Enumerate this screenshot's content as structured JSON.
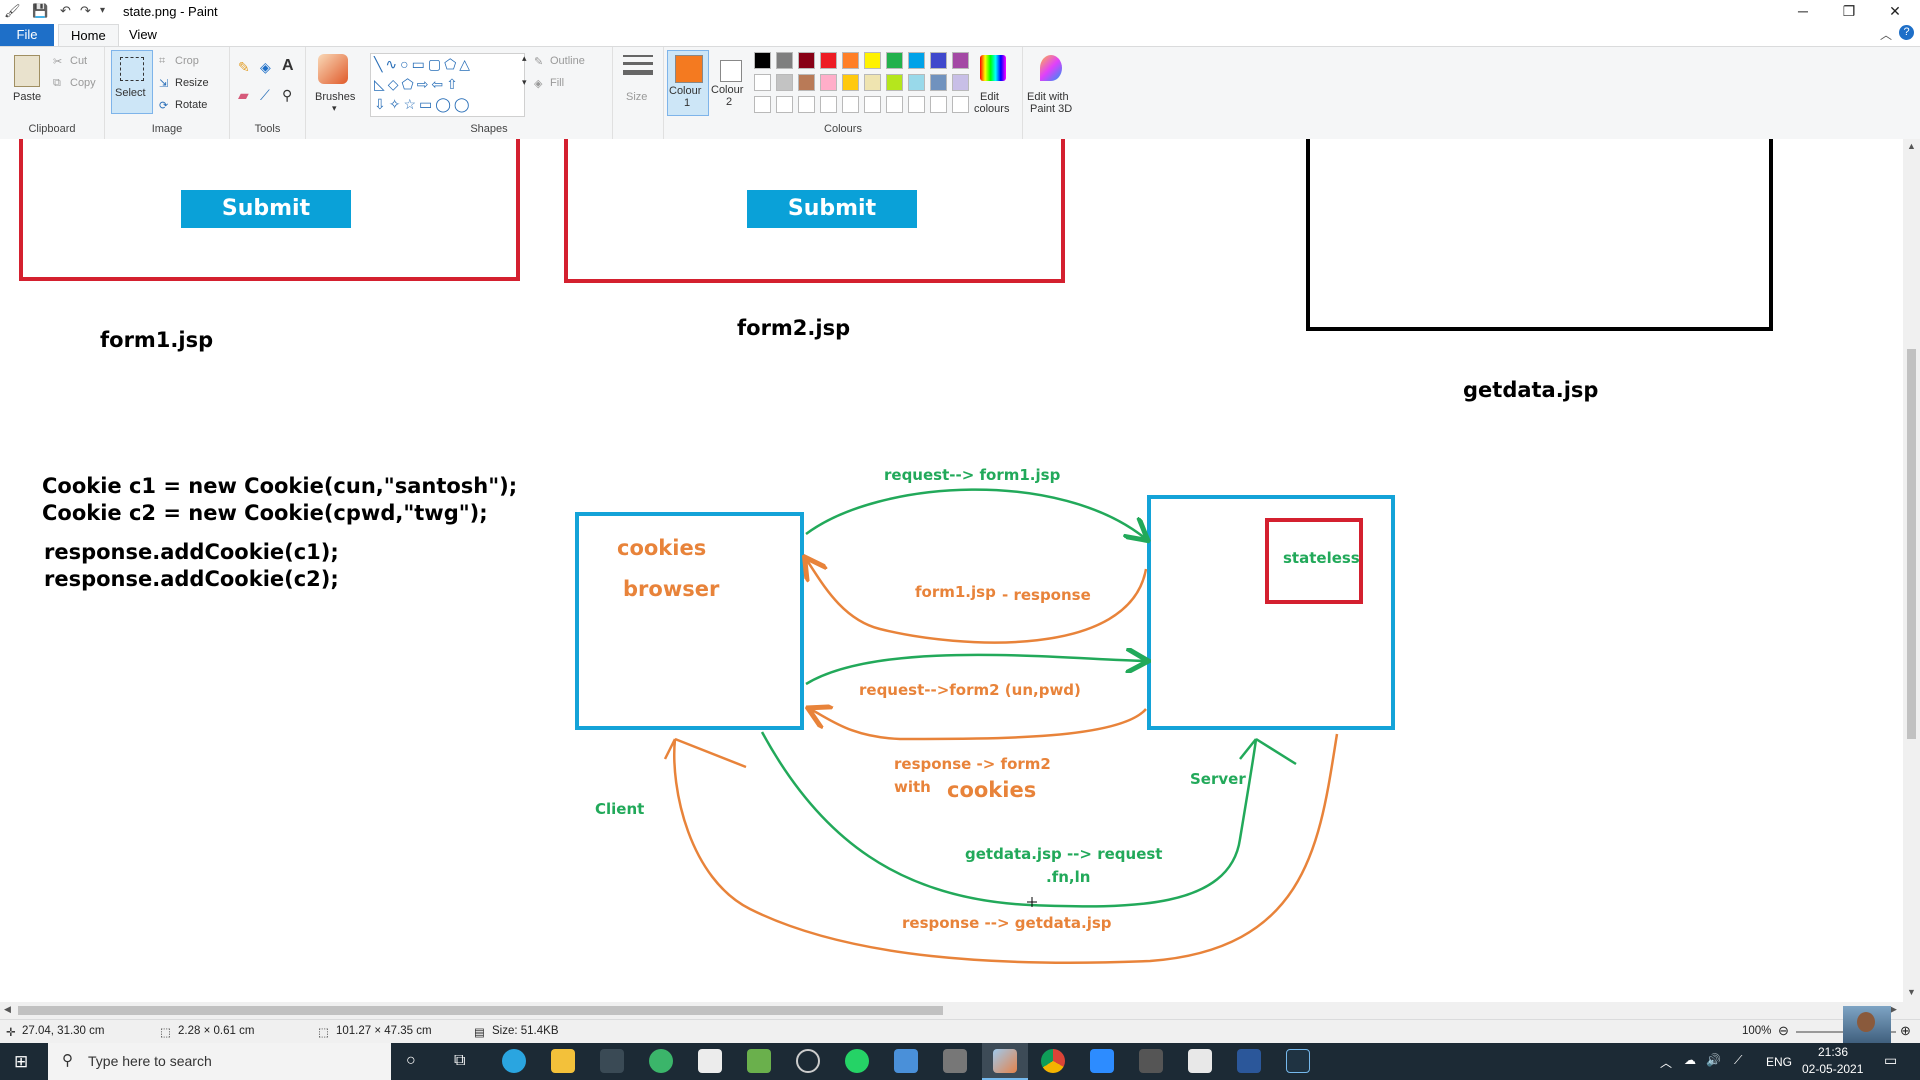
{
  "window": {
    "title": "state.png - Paint",
    "controls": {
      "minimize": "─",
      "maximize": "❐",
      "close": "✕"
    }
  },
  "tabs": {
    "file": "File",
    "home": "Home",
    "view": "View"
  },
  "ribbon": {
    "clipboard": {
      "label": "Clipboard",
      "paste": "Paste",
      "cut": "Cut",
      "copy": "Copy"
    },
    "image": {
      "label": "Image",
      "select": "Select",
      "crop": "Crop",
      "resize": "Resize",
      "rotate": "Rotate"
    },
    "tools": {
      "label": "Tools"
    },
    "brushes": {
      "label": "Brushes"
    },
    "shapes": {
      "label": "Shapes",
      "outline": "Outline",
      "fill": "Fill"
    },
    "size": {
      "label": "Size"
    },
    "colours": {
      "label": "Colours",
      "colour1": "Colour",
      "colour1_num": "1",
      "colour2": "Colour",
      "colour2_num": "2",
      "edit": "Edit",
      "edit2": "colours",
      "paint3d": "Edit with",
      "paint3d2": "Paint 3D",
      "active_colour1": "#f47a20",
      "active_colour2": "#ffffff",
      "palette_row1": [
        "#000000",
        "#7f7f7f",
        "#880015",
        "#ed1c24",
        "#ff7f27",
        "#fff200",
        "#22b14c",
        "#00a2e8",
        "#3f48cc",
        "#a349a4"
      ],
      "palette_row2": [
        "#ffffff",
        "#c3c3c3",
        "#b97a57",
        "#ffaec9",
        "#ffc90e",
        "#efe4b0",
        "#b5e61d",
        "#99d9ea",
        "#7092be",
        "#c8bfe7"
      ]
    }
  },
  "drawing": {
    "submit1": "Submit",
    "submit2": "Submit",
    "form1_label": "form1.jsp",
    "form2_label": "form2.jsp",
    "getdata_label": "getdata.jsp",
    "code": [
      "Cookie c1 = new Cookie(cun,\"santosh\");",
      "Cookie c2 = new Cookie(cpwd,\"twg\");",
      "response.addCookie(c1);",
      "response.addCookie(c2);"
    ],
    "cookies": "cookies",
    "browser": "browser",
    "stateless": "stateless",
    "client": "Client",
    "server": "Server",
    "req1": "request--> form1.jsp",
    "resp1a": "form1.jsp",
    "resp1b": "- response",
    "req2": "request-->form2 (un,pwd)",
    "resp2": "response -> form2",
    "resp2_with": "with",
    "resp2_cookies": "cookies",
    "req3": "getdata.jsp --> request",
    "req3_params": ".fn,ln",
    "resp3": "response --> getdata.jsp",
    "colors": {
      "red": "#d4202f",
      "blue": "#14a3d8",
      "green": "#22a95a",
      "orange": "#e8833a",
      "black": "#000000"
    }
  },
  "status": {
    "cursor_pos": "27.04, 31.30 cm",
    "selection_size": "2.28 × 0.61 cm",
    "image_size": "101.27 × 47.35 cm",
    "file_size": "Size: 51.4KB",
    "zoom": "100%"
  },
  "taskbar": {
    "search_placeholder": "Type here to search",
    "lang": "ENG",
    "time": "21:36",
    "date": "02-05-2021"
  }
}
